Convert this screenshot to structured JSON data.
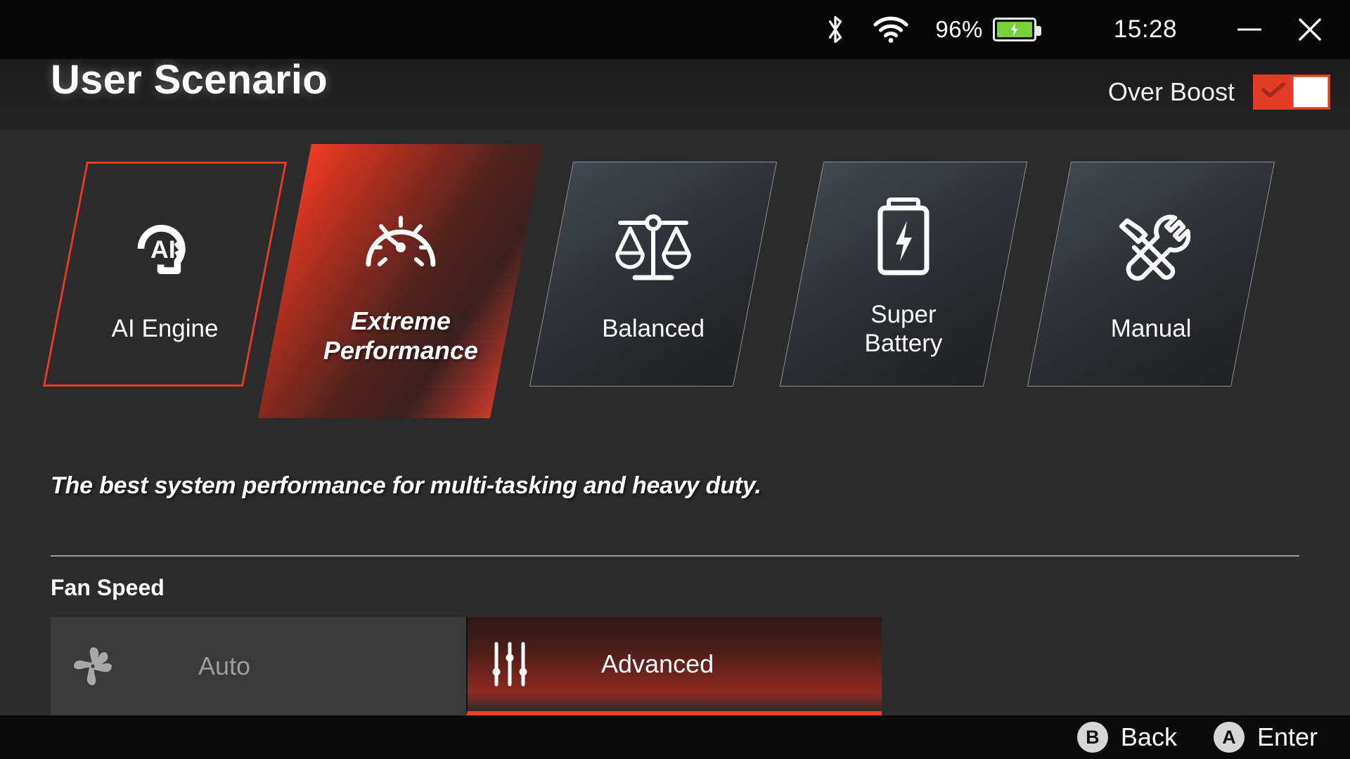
{
  "statusbar": {
    "bluetooth_icon": "bluetooth-icon",
    "wifi_icon": "wifi-icon",
    "battery_percent": "96%",
    "battery_icon": "battery-charging-icon",
    "time": "15:28",
    "minimize_label": "—",
    "close_label": "✕"
  },
  "header": {
    "title": "User Scenario",
    "over_boost": {
      "label": "Over Boost",
      "state": "on",
      "accent_color": "#e23b26"
    }
  },
  "scenarios": {
    "selected": "Extreme Performance",
    "focused": "AI Engine",
    "items": [
      {
        "id": "ai-engine",
        "label": "AI Engine",
        "icon": "ai-head-icon",
        "state": "focused"
      },
      {
        "id": "extreme",
        "label_line1": "Extreme",
        "label_line2": "Performance",
        "icon": "gauge-icon",
        "state": "selected"
      },
      {
        "id": "balanced",
        "label": "Balanced",
        "icon": "scales-icon",
        "state": "normal"
      },
      {
        "id": "battery",
        "label_line1": "Super",
        "label_line2": "Battery",
        "icon": "battery-bolt-icon",
        "state": "normal"
      },
      {
        "id": "manual",
        "label": "Manual",
        "icon": "tools-icon",
        "state": "normal"
      }
    ]
  },
  "description": "The best system performance for multi-tasking and heavy duty.",
  "fan_speed": {
    "section_label": "Fan Speed",
    "tabs": [
      {
        "id": "auto",
        "label": "Auto",
        "icon": "fan-icon",
        "state": "inactive"
      },
      {
        "id": "advanced",
        "label": "Advanced",
        "icon": "sliders-icon",
        "state": "active"
      }
    ]
  },
  "bottom_hints": [
    {
      "button": "B",
      "label": "Back"
    },
    {
      "button": "A",
      "label": "Enter"
    }
  ]
}
